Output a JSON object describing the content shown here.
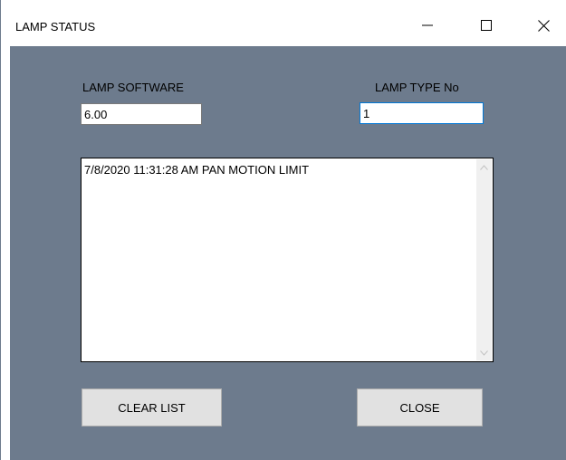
{
  "window": {
    "title": "LAMP STATUS"
  },
  "form": {
    "lamp_software_label": "LAMP SOFTWARE",
    "lamp_software_value": "6.00",
    "lamp_type_label": "LAMP TYPE No",
    "lamp_type_value": "1"
  },
  "log": {
    "items": [
      "7/8/2020 11:31:28 AM PAN MOTION LIMIT"
    ]
  },
  "buttons": {
    "clear_list_label": "CLEAR LIST",
    "close_label": "CLOSE"
  },
  "colors": {
    "client_background": "#6d7b8d",
    "titlebar_background": "#ffffff",
    "button_face": "#e1e1e1",
    "focus_border": "#0078d7"
  },
  "icons": {
    "minimize": "minimize-icon",
    "maximize": "maximize-icon",
    "close": "close-icon",
    "scroll_up": "chevron-up-icon",
    "scroll_down": "chevron-down-icon"
  }
}
